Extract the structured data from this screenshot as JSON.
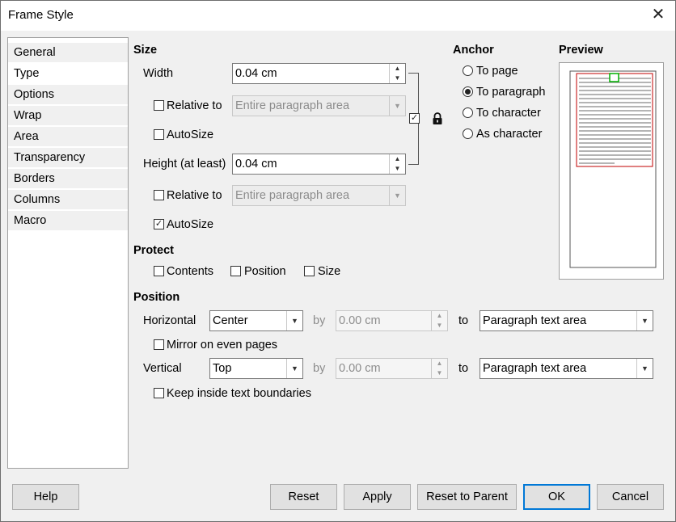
{
  "window": {
    "title": "Frame Style",
    "close_glyph": "✕"
  },
  "sidebar": {
    "items": [
      {
        "label": "General"
      },
      {
        "label": "Type",
        "selected": true
      },
      {
        "label": "Options"
      },
      {
        "label": "Wrap"
      },
      {
        "label": "Area"
      },
      {
        "label": "Transparency"
      },
      {
        "label": "Borders"
      },
      {
        "label": "Columns"
      },
      {
        "label": "Macro"
      }
    ]
  },
  "size": {
    "heading": "Size",
    "width_label": "Width",
    "width_value": "0.04 cm",
    "relative_label": "Relative to",
    "relative_value": "Entire paragraph area",
    "autosize_label": "AutoSize",
    "height_label": "Height (at least)",
    "height_value": "0.04 cm",
    "relative2_label": "Relative to",
    "relative2_value": "Entire paragraph area",
    "autosize2_label": "AutoSize",
    "keep_ratio_checked": true,
    "autosize2_checked": true
  },
  "anchor": {
    "heading": "Anchor",
    "options": [
      "To page",
      "To paragraph",
      "To character",
      "As character"
    ],
    "selected": "To paragraph"
  },
  "preview": {
    "heading": "Preview"
  },
  "protect": {
    "heading": "Protect",
    "contents_label": "Contents",
    "position_label": "Position",
    "size_label": "Size"
  },
  "position": {
    "heading": "Position",
    "horizontal_label": "Horizontal",
    "horizontal_value": "Center",
    "by_label": "by",
    "h_by_value": "0.00 cm",
    "to_label": "to",
    "h_to_value": "Paragraph text area",
    "mirror_label": "Mirror on even pages",
    "vertical_label": "Vertical",
    "vertical_value": "Top",
    "v_by_label": "by",
    "v_by_value": "0.00 cm",
    "v_to_label": "to",
    "v_to_value": "Paragraph text area",
    "keep_inside_label": "Keep inside text boundaries"
  },
  "buttons": {
    "help": "Help",
    "reset": "Reset",
    "apply": "Apply",
    "reset_parent": "Reset to Parent",
    "ok": "OK",
    "cancel": "Cancel"
  },
  "glyphs": {
    "check": "✓",
    "up": "▲",
    "down": "▼",
    "combo": "▼",
    "lock": "🔒"
  },
  "colors": {
    "accent": "#0078d7",
    "preview_frame": "#c00000",
    "preview_anchor": "#00b000"
  }
}
